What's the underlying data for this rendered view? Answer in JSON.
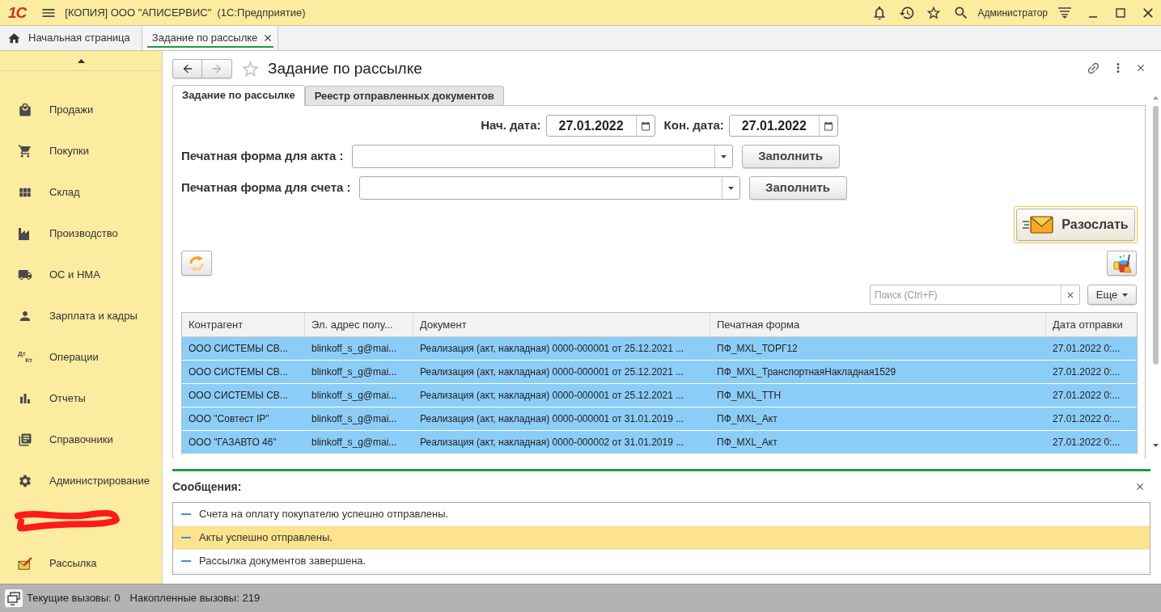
{
  "window": {
    "logo": "1С",
    "title": "[КОПИЯ] ООО \"АПИСЕРВИС\"  (1С:Предприятие)",
    "user": "Администратор"
  },
  "open_tabs": [
    {
      "kind": "home",
      "label": "Начальная страница",
      "selected": false
    },
    {
      "kind": "document",
      "label": "Задание по рассылке",
      "selected": true
    }
  ],
  "sidebar": {
    "items": [
      {
        "kind": "section",
        "label": "Продажи"
      },
      {
        "kind": "section",
        "label": "Покупки"
      },
      {
        "kind": "section",
        "label": "Склад"
      },
      {
        "kind": "section",
        "label": "Производство"
      },
      {
        "kind": "section",
        "label": "ОС и НМА"
      },
      {
        "kind": "section",
        "label": "Зарплата и кадры"
      },
      {
        "kind": "section",
        "label": "Операции",
        "icon_text": [
          "Дт",
          "Кт"
        ]
      },
      {
        "kind": "section",
        "label": "Отчеты"
      },
      {
        "kind": "section",
        "label": "Справочники"
      },
      {
        "kind": "section",
        "label": "Администрирование"
      },
      {
        "kind": "redacted"
      },
      {
        "kind": "section",
        "label": "Рассылка"
      }
    ]
  },
  "form": {
    "title": "Задание по рассылке",
    "favorite": false,
    "back_disabled": false,
    "forward_disabled": true,
    "tabs": [
      {
        "label": "Задание по рассылке",
        "selected": true
      },
      {
        "label": "Реестр отправленных документов",
        "selected": false
      }
    ],
    "start_date": {
      "label": "Нач. дата:",
      "value": "27.01.2022"
    },
    "end_date": {
      "label": "Кон. дата:",
      "value": "27.01.2022"
    },
    "print_forms": [
      {
        "label": "Печатная форма для акта :",
        "button": "Заполнить"
      },
      {
        "label": "Печатная форма для счета :",
        "button": "Заполнить"
      }
    ],
    "send_button": {
      "label": "Разослать",
      "focused": true
    },
    "search": {
      "placeholder": "Поиск (Ctrl+F)"
    },
    "more_button": "Еще",
    "table": {
      "columns": [
        "Контрагент",
        "Эл. адрес полу...",
        "Документ",
        "Печатная форма",
        "Дата отправки"
      ],
      "rows": [
        {
          "selected": true,
          "cells": [
            "ООО СИСТЕМЫ СВ...",
            "blinkoff_s_g@mai...",
            "Реализация (акт, накладная) 0000-000001 от 25.12.2021 ...",
            "ПФ_MXL_ТОРГ12",
            "27.01.2022 0:..."
          ]
        },
        {
          "selected": true,
          "cells": [
            "ООО СИСТЕМЫ СВ...",
            "blinkoff_s_g@mai...",
            "Реализация (акт, накладная) 0000-000001 от 25.12.2021 ...",
            "ПФ_MXL_ТранспортнаяНакладная1529",
            "27.01.2022 0:..."
          ]
        },
        {
          "selected": true,
          "cells": [
            "ООО СИСТЕМЫ СВ...",
            "blinkoff_s_g@mai...",
            "Реализация (акт, накладная) 0000-000001 от 25.12.2021 ...",
            "ПФ_MXL_ТТН",
            "27.01.2022 0:..."
          ]
        },
        {
          "selected": true,
          "cells": [
            "ООО \"Совтест IP\"",
            "blinkoff_s_g@mai...",
            "Реализация (акт, накладная) 0000-000001 от 31.01.2019 ...",
            "ПФ_MXL_Акт",
            "27.01.2022 0:..."
          ]
        },
        {
          "selected": true,
          "cells": [
            "ООО \"ГАЗАВТО 46\"",
            "blinkoff_s_g@mai...",
            "Реализация (акт, накладная) 0000-000002 от 31.01.2019 ...",
            "ПФ_MXL_Акт",
            "27.01.2022 0:..."
          ]
        }
      ]
    }
  },
  "messages": {
    "title": "Сообщения:",
    "items": [
      {
        "text": "Счета на оплату покупателю успешно отправлены.",
        "selected": false
      },
      {
        "text": "Акты успешно отправлены.",
        "selected": true
      },
      {
        "text": "Рассылка документов завершена.",
        "selected": false
      }
    ]
  },
  "status_bar": {
    "current_calls": "Текущие вызовы: 0",
    "accumulated_calls": "Накопленные вызовы: 219"
  }
}
